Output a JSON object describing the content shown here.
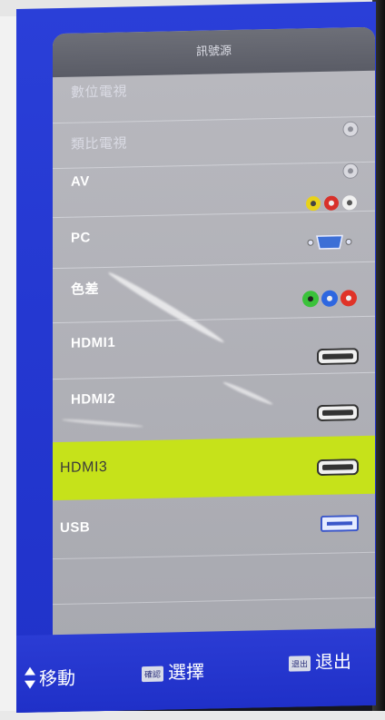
{
  "menu": {
    "title": "訊號源",
    "items": [
      {
        "label": "數位電視",
        "icon": "antenna-icon",
        "selected": false,
        "dim": true
      },
      {
        "label": "類比電視",
        "icon": "antenna-icon",
        "selected": false,
        "dim": true
      },
      {
        "label": "AV",
        "icon": "rca-av-icon",
        "selected": false,
        "dim": false
      },
      {
        "label": "PC",
        "icon": "vga-port-icon",
        "selected": false,
        "dim": false
      },
      {
        "label": "色差",
        "icon": "component-rca-icon",
        "selected": false,
        "dim": false
      },
      {
        "label": "HDMI1",
        "icon": "hdmi-port-icon",
        "selected": false,
        "dim": false
      },
      {
        "label": "HDMI2",
        "icon": "hdmi-port-icon",
        "selected": false,
        "dim": false
      },
      {
        "label": "HDMI3",
        "icon": "hdmi-port-icon",
        "selected": true,
        "dim": false
      },
      {
        "label": "USB",
        "icon": "usb-port-icon",
        "selected": false,
        "dim": false
      }
    ]
  },
  "footer": {
    "move_label": "移動",
    "select_key": "確認",
    "select_label": "選擇",
    "exit_key": "退出",
    "exit_label": "退出"
  },
  "colors": {
    "screen_blue": "#2438d1",
    "menu_gray": "#a8a9b0",
    "highlight": "#c6e21a"
  }
}
